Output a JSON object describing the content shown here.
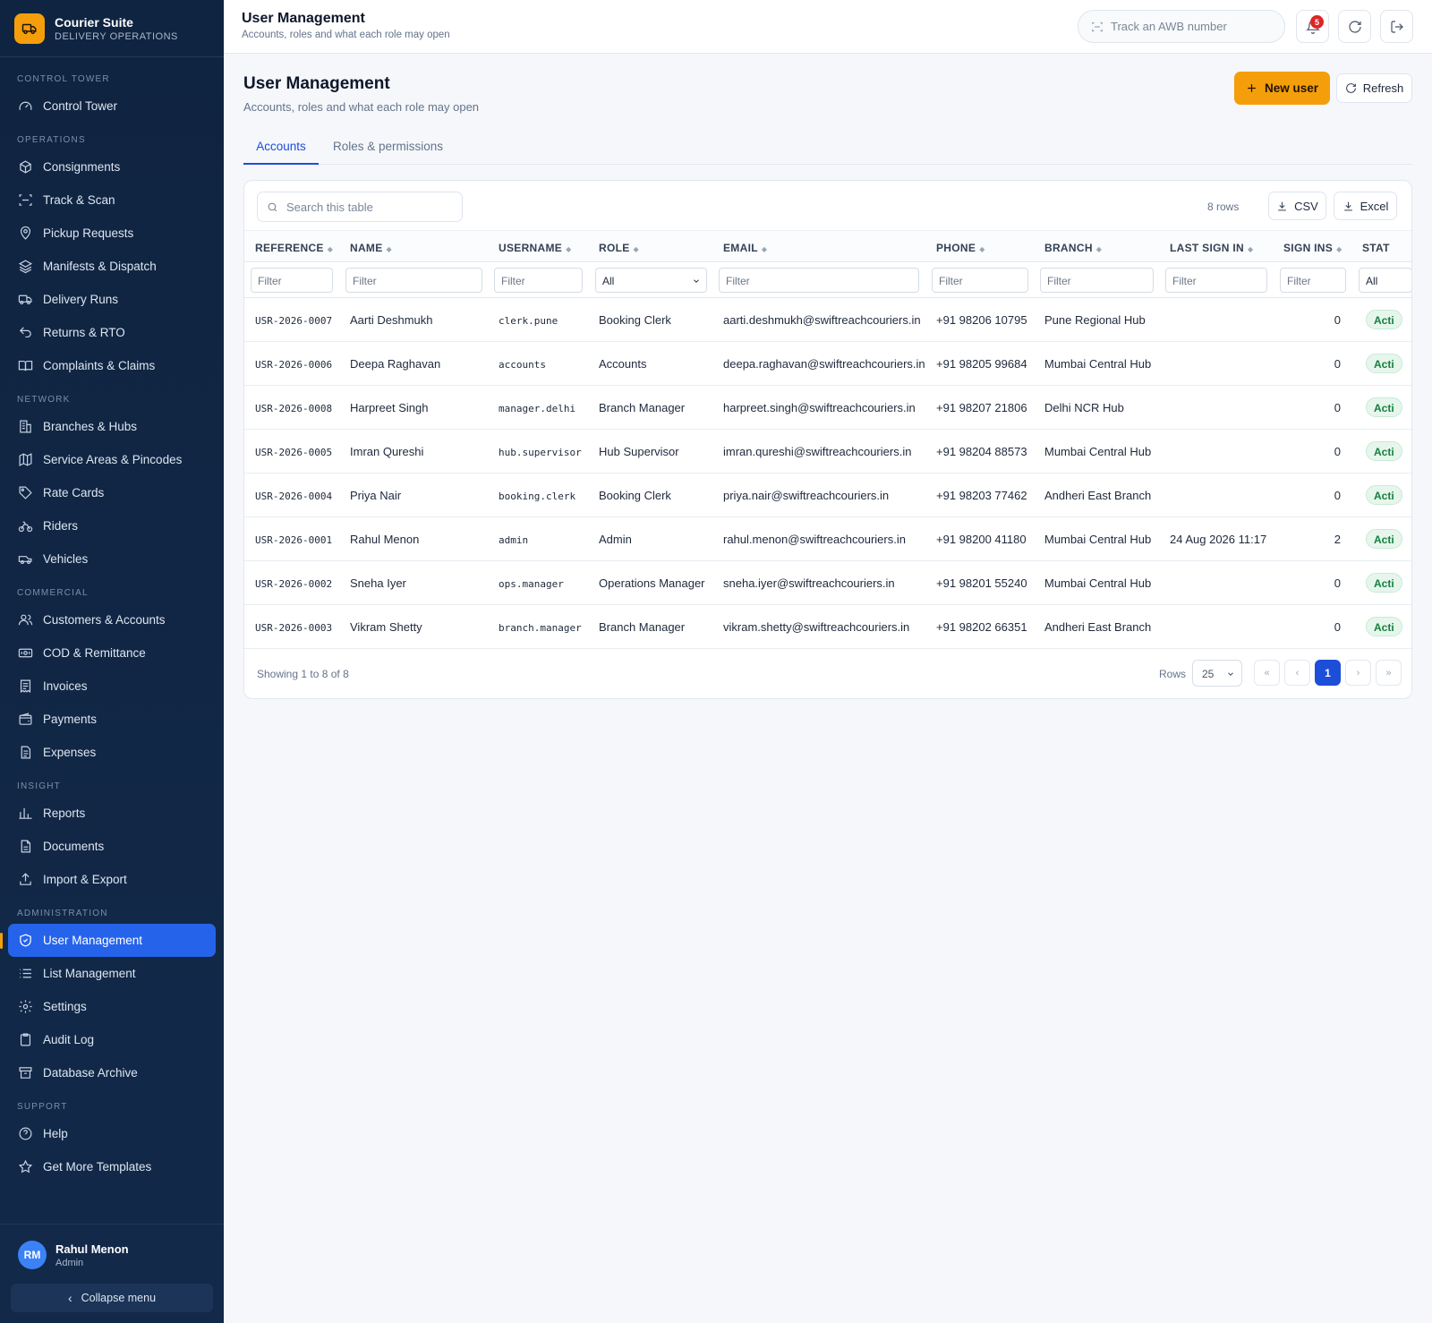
{
  "brand": {
    "name": "Courier Suite",
    "subtitle": "DELIVERY OPERATIONS",
    "accent": "#f59e0b"
  },
  "sidebar": {
    "sections": [
      {
        "title": "CONTROL TOWER",
        "items": [
          {
            "label": "Control Tower",
            "icon": "gauge-icon"
          }
        ]
      },
      {
        "title": "OPERATIONS",
        "items": [
          {
            "label": "Consignments",
            "icon": "package-icon"
          },
          {
            "label": "Track & Scan",
            "icon": "scan-icon"
          },
          {
            "label": "Pickup Requests",
            "icon": "map-pin-icon"
          },
          {
            "label": "Manifests & Dispatch",
            "icon": "layers-icon"
          },
          {
            "label": "Delivery Runs",
            "icon": "truck-icon"
          },
          {
            "label": "Returns & RTO",
            "icon": "undo-icon"
          },
          {
            "label": "Complaints & Claims",
            "icon": "book-open-icon"
          }
        ]
      },
      {
        "title": "NETWORK",
        "items": [
          {
            "label": "Branches & Hubs",
            "icon": "building-icon"
          },
          {
            "label": "Service Areas & Pincodes",
            "icon": "map-icon"
          },
          {
            "label": "Rate Cards",
            "icon": "tag-icon"
          },
          {
            "label": "Riders",
            "icon": "bike-icon"
          },
          {
            "label": "Vehicles",
            "icon": "van-icon"
          }
        ]
      },
      {
        "title": "COMMERCIAL",
        "items": [
          {
            "label": "Customers & Accounts",
            "icon": "users-icon"
          },
          {
            "label": "COD & Remittance",
            "icon": "banknote-icon"
          },
          {
            "label": "Invoices",
            "icon": "receipt-icon"
          },
          {
            "label": "Payments",
            "icon": "wallet-icon"
          },
          {
            "label": "Expenses",
            "icon": "file-text-icon"
          }
        ]
      },
      {
        "title": "INSIGHT",
        "items": [
          {
            "label": "Reports",
            "icon": "bar-chart-icon"
          },
          {
            "label": "Documents",
            "icon": "document-icon"
          },
          {
            "label": "Import & Export",
            "icon": "upload-icon"
          }
        ]
      },
      {
        "title": "ADMINISTRATION",
        "items": [
          {
            "label": "User Management",
            "icon": "shield-check-icon",
            "active": true
          },
          {
            "label": "List Management",
            "icon": "list-icon"
          },
          {
            "label": "Settings",
            "icon": "gear-icon"
          },
          {
            "label": "Audit Log",
            "icon": "clipboard-icon"
          },
          {
            "label": "Database Archive",
            "icon": "archive-icon"
          }
        ]
      },
      {
        "title": "SUPPORT",
        "items": [
          {
            "label": "Help",
            "icon": "help-circle-icon"
          },
          {
            "label": "Get More Templates",
            "icon": "star-icon"
          }
        ]
      }
    ],
    "user": {
      "initials": "RM",
      "name": "Rahul Menon",
      "role": "Admin"
    },
    "collapse_label": "Collapse menu"
  },
  "topbar": {
    "title": "User Management",
    "subtitle": "Accounts, roles and what each role may open",
    "awb_placeholder": "Track an AWB number",
    "notification_count": "5"
  },
  "page": {
    "title": "User Management",
    "subtitle": "Accounts, roles and what each role may open",
    "new_user_label": "New user",
    "refresh_label": "Refresh",
    "tabs": [
      {
        "label": "Accounts",
        "active": true
      },
      {
        "label": "Roles & permissions",
        "active": false
      }
    ]
  },
  "table": {
    "search_placeholder": "Search this table",
    "row_count": "8 rows",
    "csv_label": "CSV",
    "excel_label": "Excel",
    "columns": [
      "REFERENCE",
      "NAME",
      "USERNAME",
      "ROLE",
      "EMAIL",
      "PHONE",
      "BRANCH",
      "LAST SIGN IN",
      "SIGN INS",
      "STAT"
    ],
    "filter_placeholder": "Filter",
    "role_filter_value": "All",
    "status_filter_value": "All",
    "rows": [
      {
        "reference": "USR-2026-0007",
        "name": "Aarti Deshmukh",
        "username": "clerk.pune",
        "role": "Booking Clerk",
        "email": "aarti.deshmukh@swiftreachcouriers.in",
        "phone": "+91 98206 10795",
        "branch": "Pune Regional Hub",
        "last_sign_in": "",
        "sign_ins": "0",
        "status": "Acti"
      },
      {
        "reference": "USR-2026-0006",
        "name": "Deepa Raghavan",
        "username": "accounts",
        "role": "Accounts",
        "email": "deepa.raghavan@swiftreachcouriers.in",
        "phone": "+91 98205 99684",
        "branch": "Mumbai Central Hub",
        "last_sign_in": "",
        "sign_ins": "0",
        "status": "Acti"
      },
      {
        "reference": "USR-2026-0008",
        "name": "Harpreet Singh",
        "username": "manager.delhi",
        "role": "Branch Manager",
        "email": "harpreet.singh@swiftreachcouriers.in",
        "phone": "+91 98207 21806",
        "branch": "Delhi NCR Hub",
        "last_sign_in": "",
        "sign_ins": "0",
        "status": "Acti"
      },
      {
        "reference": "USR-2026-0005",
        "name": "Imran Qureshi",
        "username": "hub.supervisor",
        "role": "Hub Supervisor",
        "email": "imran.qureshi@swiftreachcouriers.in",
        "phone": "+91 98204 88573",
        "branch": "Mumbai Central Hub",
        "last_sign_in": "",
        "sign_ins": "0",
        "status": "Acti"
      },
      {
        "reference": "USR-2026-0004",
        "name": "Priya Nair",
        "username": "booking.clerk",
        "role": "Booking Clerk",
        "email": "priya.nair@swiftreachcouriers.in",
        "phone": "+91 98203 77462",
        "branch": "Andheri East Branch",
        "last_sign_in": "",
        "sign_ins": "0",
        "status": "Acti"
      },
      {
        "reference": "USR-2026-0001",
        "name": "Rahul Menon",
        "username": "admin",
        "role": "Admin",
        "email": "rahul.menon@swiftreachcouriers.in",
        "phone": "+91 98200 41180",
        "branch": "Mumbai Central Hub",
        "last_sign_in": "24 Aug 2026 11:17",
        "sign_ins": "2",
        "status": "Acti"
      },
      {
        "reference": "USR-2026-0002",
        "name": "Sneha Iyer",
        "username": "ops.manager",
        "role": "Operations Manager",
        "email": "sneha.iyer@swiftreachcouriers.in",
        "phone": "+91 98201 55240",
        "branch": "Mumbai Central Hub",
        "last_sign_in": "",
        "sign_ins": "0",
        "status": "Acti"
      },
      {
        "reference": "USR-2026-0003",
        "name": "Vikram Shetty",
        "username": "branch.manager",
        "role": "Branch Manager",
        "email": "vikram.shetty@swiftreachcouriers.in",
        "phone": "+91 98202 66351",
        "branch": "Andheri East Branch",
        "last_sign_in": "",
        "sign_ins": "0",
        "status": "Acti"
      }
    ],
    "footer": {
      "showing": "Showing 1 to 8 of 8",
      "rows_label": "Rows",
      "rows_per_page": "25",
      "first": "«",
      "prev": "‹",
      "current_page": "1",
      "next": "›",
      "last": "»"
    }
  }
}
